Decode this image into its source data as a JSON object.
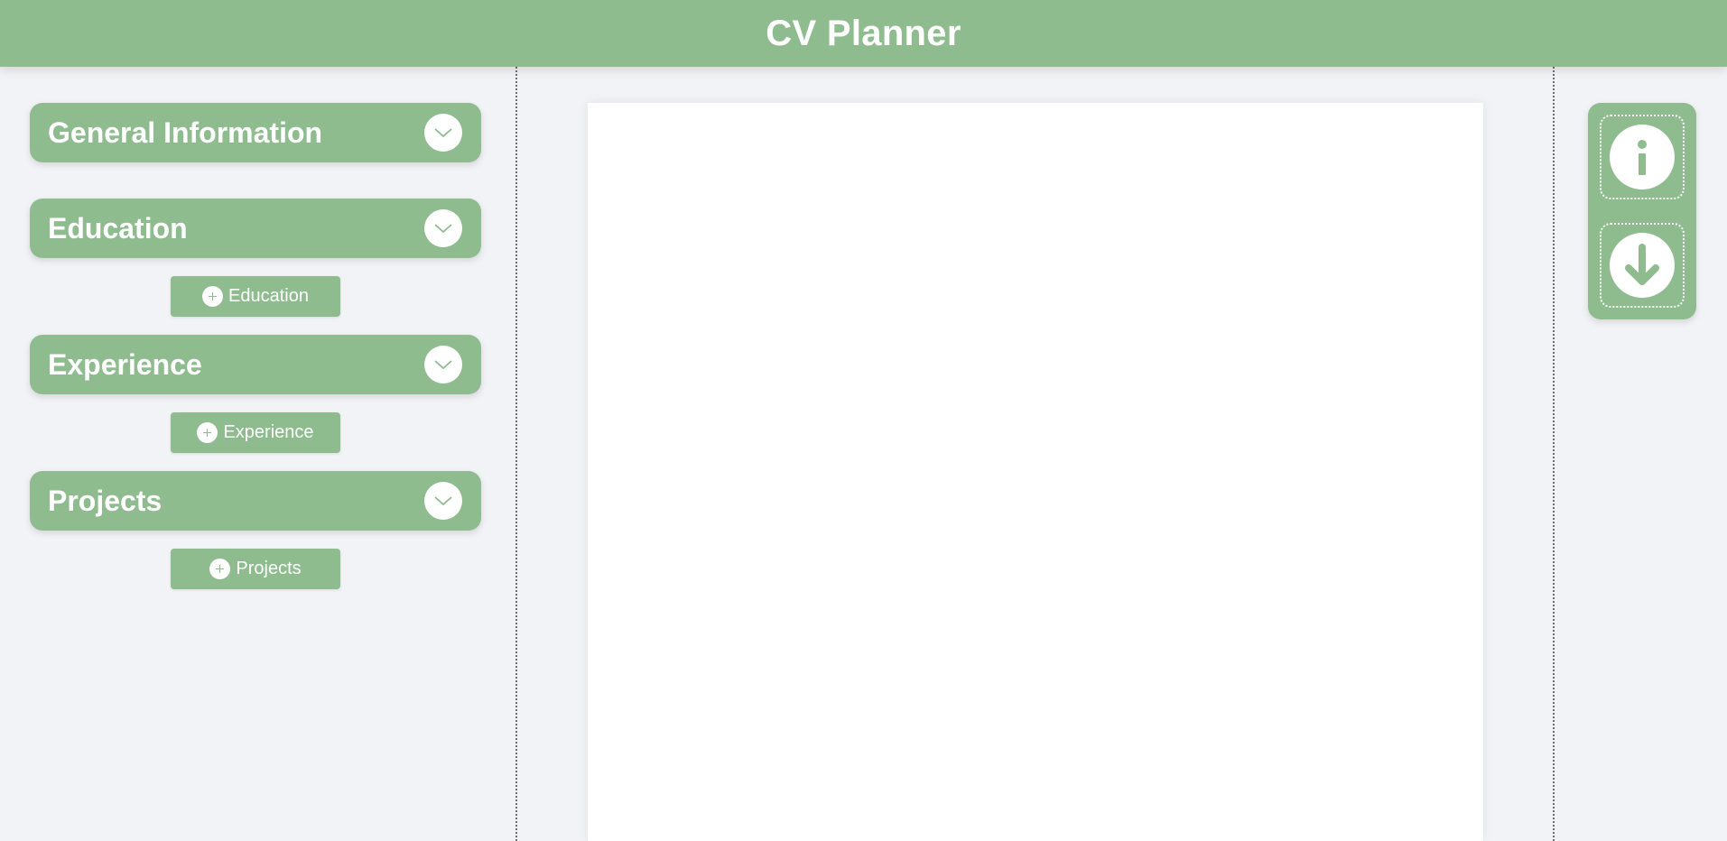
{
  "header": {
    "title": "CV Planner"
  },
  "sidebar": {
    "sections": [
      {
        "title": "General Information",
        "toggle_icon": "chevron-down-icon"
      },
      {
        "title": "Education",
        "toggle_icon": "chevron-down-icon",
        "add_label": "Education"
      },
      {
        "title": "Experience",
        "toggle_icon": "chevron-down-icon",
        "add_label": "Experience"
      },
      {
        "title": "Projects",
        "toggle_icon": "chevron-down-icon",
        "add_label": "Projects"
      }
    ]
  },
  "toolbar": {
    "buttons": [
      {
        "icon": "info-icon"
      },
      {
        "icon": "download-icon"
      }
    ]
  },
  "colors": {
    "accent": "#8fbc8f",
    "background": "#f2f3f6",
    "page": "#ffffff"
  }
}
